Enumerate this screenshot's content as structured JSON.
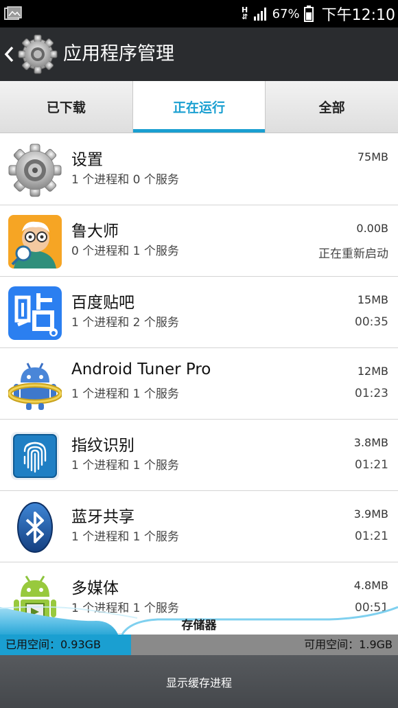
{
  "status_bar": {
    "net_type_top": "H",
    "net_type_bottom": "⇵",
    "battery_percent": "67%",
    "time": "下午12:10"
  },
  "header": {
    "title": "应用程序管理",
    "back_icon": "chevron-left-icon",
    "app_icon": "gear-icon"
  },
  "tabs": [
    {
      "label": "已下载",
      "active": false
    },
    {
      "label": "正在运行",
      "active": true
    },
    {
      "label": "全部",
      "active": false
    }
  ],
  "apps": [
    {
      "name": "设置",
      "desc": "1 个进程和 0 个服务",
      "size": "75MB",
      "time": "",
      "icon": "settings-gear-icon"
    },
    {
      "name": "鲁大师",
      "desc": "0 个进程和 1 个服务",
      "size": "0.00B",
      "time": "正在重新启动",
      "icon": "ludashi-icon"
    },
    {
      "name": "百度贴吧",
      "desc": "1 个进程和 2 个服务",
      "size": "15MB",
      "time": "00:35",
      "icon": "tieba-icon"
    },
    {
      "name": "Android Tuner Pro",
      "desc": "1 个进程和 1 个服务",
      "size": "12MB",
      "time": "01:23",
      "icon": "android-tuner-icon"
    },
    {
      "name": "指纹识别",
      "desc": "1 个进程和 1 个服务",
      "size": "3.8MB",
      "time": "01:21",
      "icon": "fingerprint-icon"
    },
    {
      "name": "蓝牙共享",
      "desc": "1 个进程和 1 个服务",
      "size": "3.9MB",
      "time": "01:21",
      "icon": "bluetooth-icon"
    },
    {
      "name": "多媒体",
      "desc": "1 个进程和 1 个服务",
      "size": "4.8MB",
      "time": "00:51",
      "icon": "android-media-icon"
    }
  ],
  "storage": {
    "label": "存储器",
    "used_text": "已用空间：0.93GB",
    "free_text": "可用空间：1.9GB",
    "used_fraction": 0.33
  },
  "bottom_button": "显示缓存进程",
  "colors": {
    "accent": "#1a9fd1",
    "header_bg": "#2a2c2f",
    "bottom_bg": "#4e5155"
  }
}
